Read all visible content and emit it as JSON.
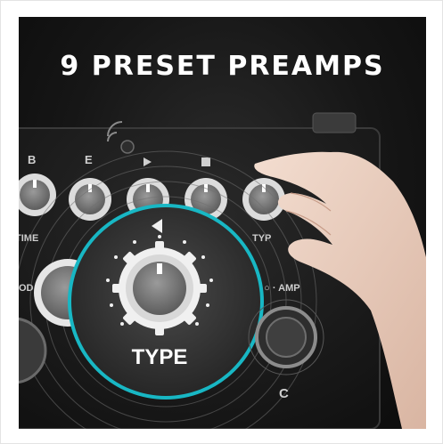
{
  "headline": "9 PRESET PREAMPS",
  "labels": {
    "knob_b": "B",
    "knob_e": "E",
    "time": "TIME",
    "type_small": "TYP",
    "mod": "OD",
    "amp": "E · ○ · AMP",
    "footswitch": "C",
    "type_zoom": "TYPE"
  },
  "colors": {
    "accent": "#18b7c4",
    "pedal": "#1e1e1e",
    "background": "#111111"
  }
}
